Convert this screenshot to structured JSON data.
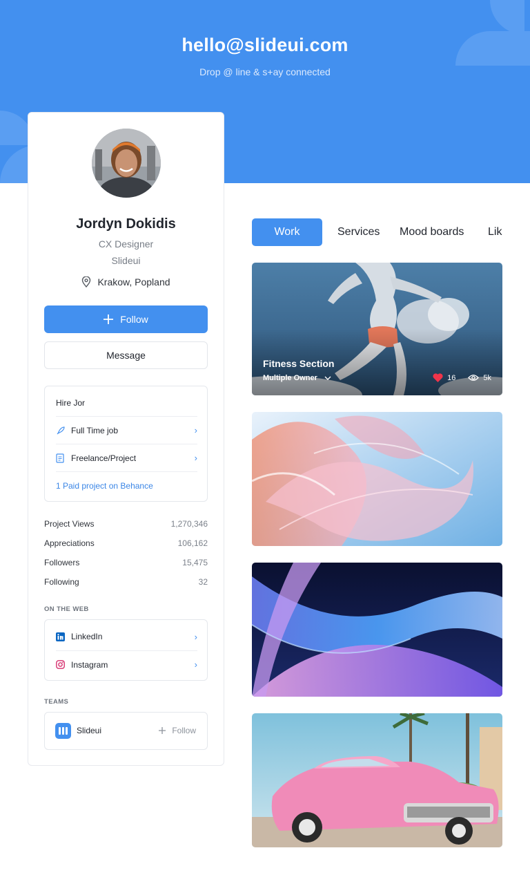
{
  "hero": {
    "email": "hello@slideui.com",
    "tagline": "Drop @ line & s+ay connected"
  },
  "profile": {
    "name": "Jordyn Dokidis",
    "role": "CX Designer",
    "company": "Slideui",
    "location": "Krakow, Popland",
    "follow_label": "Follow",
    "message_label": "Message"
  },
  "hire": {
    "title": "Hire Jor",
    "options": [
      "Full Time job",
      "Freelance/Project"
    ],
    "paid_link": "1 Paid project on Behance"
  },
  "stats": [
    {
      "label": "Project Views",
      "value": "1,270,346"
    },
    {
      "label": "Appreciations",
      "value": "106,162"
    },
    {
      "label": "Followers",
      "value": "15,475"
    },
    {
      "label": "Following",
      "value": "32"
    }
  ],
  "web": {
    "heading": "ON THE WEB",
    "links": [
      "LinkedIn",
      "Instagram"
    ]
  },
  "teams": {
    "heading": "TEAMS",
    "name": "Slideui",
    "follow_label": "Follow"
  },
  "tabs": [
    "Work",
    "Services",
    "Mood boards",
    "Lik"
  ],
  "projects": [
    {
      "title": "Fitness Section",
      "owner": "Multiple Owner",
      "likes": "16",
      "views": "5k"
    }
  ],
  "colors": {
    "accent": "#4390ef",
    "text": "#22262e",
    "muted": "#777d86",
    "heart": "#f0344a"
  },
  "icons": [
    "plus-icon",
    "location-pin-icon",
    "rocket-icon",
    "document-icon",
    "chevron-right-icon",
    "linkedin-icon",
    "instagram-icon",
    "chevron-down-icon",
    "heart-icon",
    "eye-icon"
  ]
}
